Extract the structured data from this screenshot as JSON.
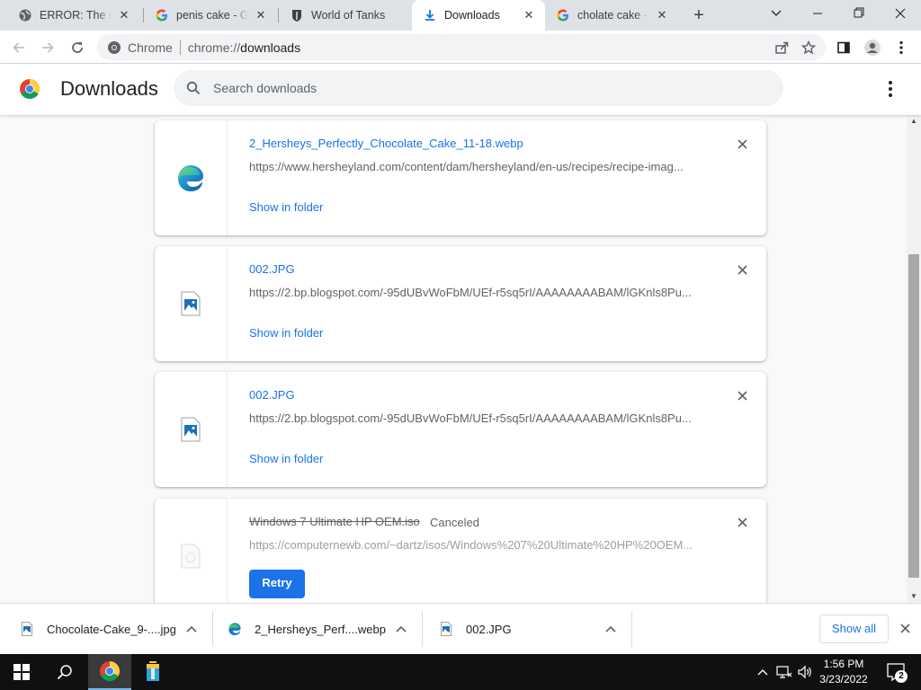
{
  "tabs": [
    {
      "title": "ERROR: The requested URL could not be retrieved",
      "icon": "globe-icon",
      "active": false
    },
    {
      "title": "penis cake - Google Search",
      "icon": "google-icon",
      "active": false
    },
    {
      "title": "World of Tanks",
      "icon": "wot-icon",
      "active": false
    },
    {
      "title": "Downloads",
      "icon": "download-icon",
      "active": true
    },
    {
      "title": "cholate cake - Google Search",
      "icon": "google-icon",
      "active": false
    }
  ],
  "omnibox": {
    "chip": "Chrome",
    "url_scheme": "chrome://",
    "url_host": "downloads"
  },
  "page": {
    "title": "Downloads",
    "search_placeholder": "Search downloads"
  },
  "downloads": [
    {
      "name": "2_Hersheys_Perfectly_Chocolate_Cake_11-18.webp",
      "url": "https://www.hersheyland.com/content/dam/hersheyland/en-us/recipes/recipe-imag...",
      "action": "Show in folder",
      "status": "",
      "icon": "edge-icon"
    },
    {
      "name": "002.JPG",
      "url": "https://2.bp.blogspot.com/-95dUBvWoFbM/UEf-r5sq5rI/AAAAAAAABAM/lGKnls8Pu...",
      "action": "Show in folder",
      "status": "",
      "icon": "image-file-icon"
    },
    {
      "name": "002.JPG",
      "url": "https://2.bp.blogspot.com/-95dUBvWoFbM/UEf-r5sq5rI/AAAAAAAABAM/lGKnls8Pu...",
      "action": "Show in folder",
      "status": "",
      "icon": "image-file-icon"
    },
    {
      "name": "Windows 7 Ultimate HP OEM.iso",
      "url": "https://computernewb.com/~dartz/isos/Windows%207%20Ultimate%20HP%20OEM...",
      "action": "Retry",
      "status": "Canceled",
      "icon": "blank-file-icon"
    }
  ],
  "shelf": {
    "items": [
      {
        "name": "Chocolate-Cake_9-....jpg",
        "icon": "image-file-icon"
      },
      {
        "name": "2_Hersheys_Perf....webp",
        "icon": "edge-icon"
      },
      {
        "name": "002.JPG",
        "icon": "image-file-icon"
      }
    ],
    "show_all": "Show all"
  },
  "taskbar": {
    "time": "1:56 PM",
    "date": "3/23/2022",
    "notifications": "2"
  },
  "colors": {
    "accent": "#1a73e8",
    "tabstrip": "#dee1e6",
    "taskbar": "#101010"
  }
}
